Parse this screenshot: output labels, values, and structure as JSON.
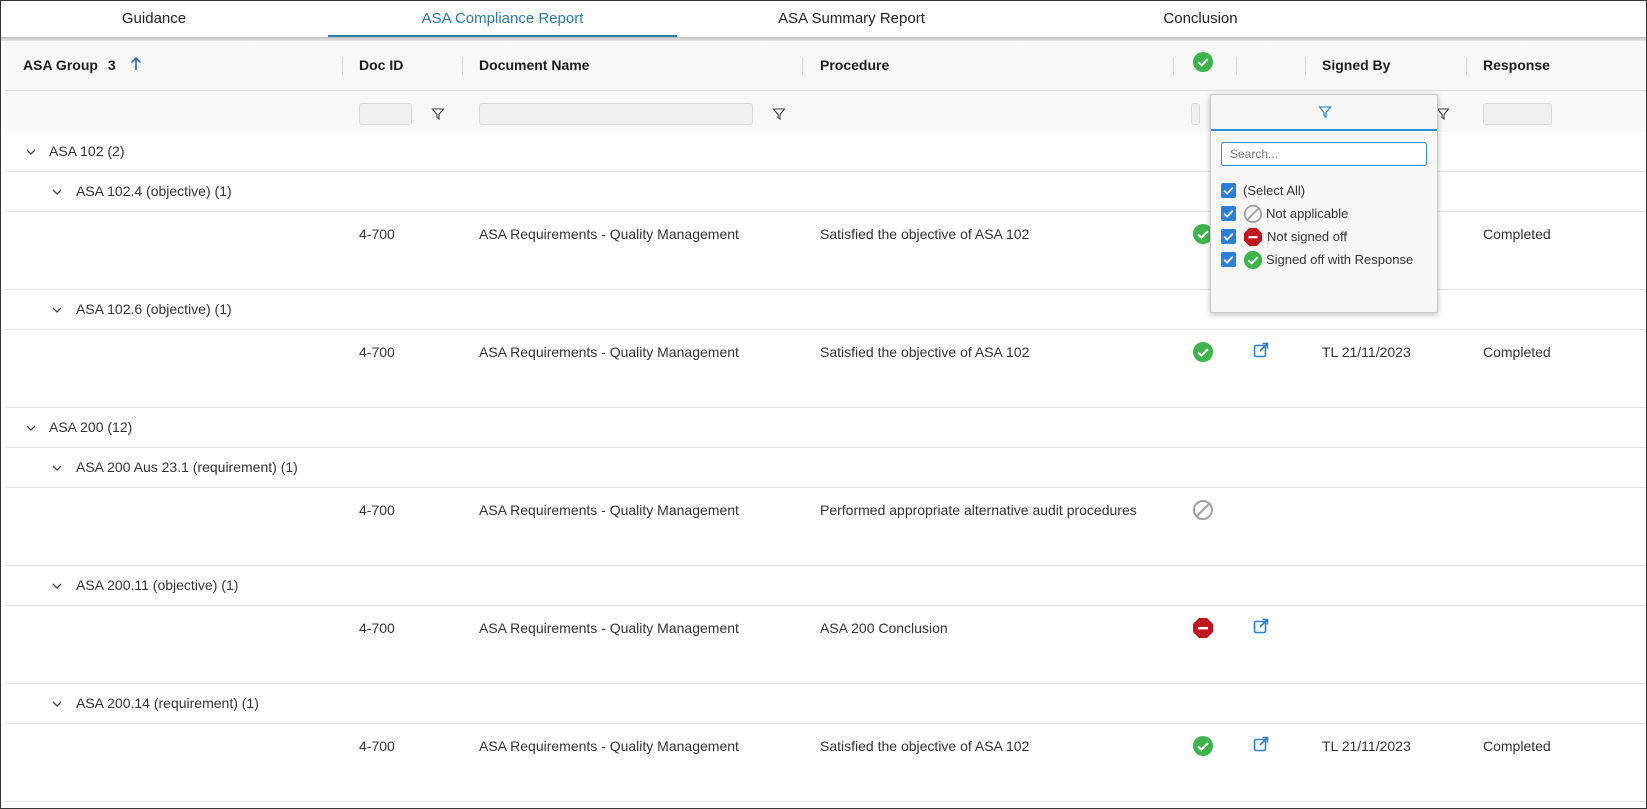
{
  "tabs": [
    {
      "label": "Guidance"
    },
    {
      "label": "ASA Compliance Report"
    },
    {
      "label": "ASA Summary Report"
    },
    {
      "label": "Conclusion"
    }
  ],
  "columns": {
    "asa_group": "ASA Group",
    "asa_group_badge": "3",
    "doc_id": "Doc ID",
    "doc_name": "Document Name",
    "procedure": "Procedure",
    "signed_by": "Signed By",
    "response": "Response"
  },
  "rows": [
    {
      "label": "ASA 102",
      "count": "(2)"
    },
    {
      "label": "ASA 102.4 (objective)",
      "count": "(1)"
    },
    {
      "doc_id": "4-700",
      "doc_name": "ASA Requirements - Quality Management",
      "procedure": "Satisfied the objective of ASA 102",
      "status": "signed-off-icon",
      "signed_by": "",
      "response": "Completed"
    },
    {
      "label": "ASA 102.6 (objective)",
      "count": "(1)"
    },
    {
      "doc_id": "4-700",
      "doc_name": "ASA Requirements - Quality Management",
      "procedure": "Satisfied the objective of ASA 102",
      "status": "signed-off-icon",
      "signed_by": "TL 21/11/2023",
      "response": "Completed"
    },
    {
      "label": "ASA 200",
      "count": "(12)"
    },
    {
      "label": "ASA 200 Aus 23.1 (requirement)",
      "count": "(1)"
    },
    {
      "doc_id": "4-700",
      "doc_name": "ASA Requirements - Quality Management",
      "procedure": "Performed appropriate alternative audit procedures",
      "status": "not-applicable-icon",
      "signed_by": "",
      "response": ""
    },
    {
      "label": "ASA 200.11 (objective)",
      "count": "(1)"
    },
    {
      "doc_id": "4-700",
      "doc_name": "ASA Requirements - Quality Management",
      "procedure": "ASA 200 Conclusion",
      "status": "not-signed-off-icon",
      "signed_by": "",
      "response": ""
    },
    {
      "label": "ASA 200.14 (requirement)",
      "count": "(1)"
    },
    {
      "doc_id": "4-700",
      "doc_name": "ASA Requirements - Quality Management",
      "procedure": "Satisfied the objective of ASA 102",
      "status": "signed-off-icon",
      "signed_by": "TL 21/11/2023",
      "response": "Completed"
    }
  ],
  "filter_popup": {
    "search_placeholder": "Search...",
    "options": [
      {
        "label": "(Select All)",
        "checked": true
      },
      {
        "label": "Not applicable",
        "checked": true,
        "icon": "not-applicable-icon"
      },
      {
        "label": "Not signed off",
        "checked": true,
        "icon": "not-signed-off-icon"
      },
      {
        "label": "Signed off with Response",
        "checked": true,
        "icon": "signed-off-icon"
      }
    ]
  },
  "colors": {
    "accent": "#2b7ba8",
    "signed_off": "#3cb44b",
    "not_signed_off": "#c0161f",
    "not_applicable": "#a0a0a0",
    "link": "#2b7fc4"
  }
}
